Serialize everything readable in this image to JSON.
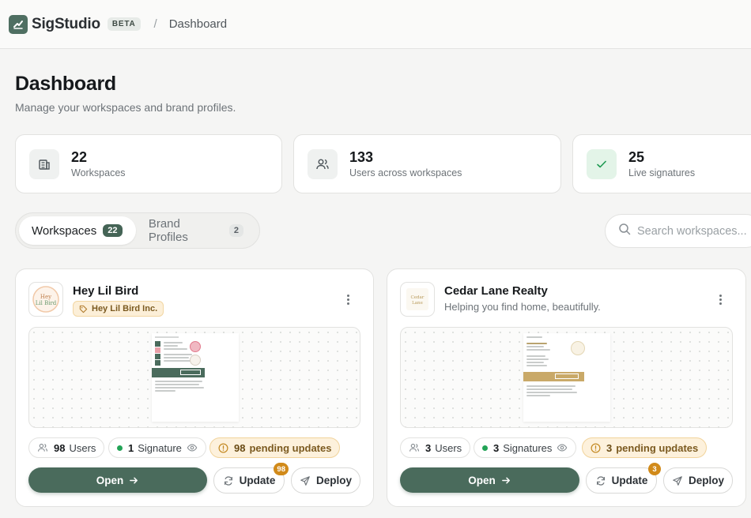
{
  "header": {
    "brand": "SigStudio",
    "beta": "BETA",
    "separator": "/",
    "breadcrumb": "Dashboard"
  },
  "page": {
    "title": "Dashboard",
    "subtitle": "Manage your workspaces and brand profiles."
  },
  "stats": [
    {
      "value": "22",
      "label": "Workspaces",
      "icon": "building-icon"
    },
    {
      "value": "133",
      "label": "Users across workspaces",
      "icon": "users-icon"
    },
    {
      "value": "25",
      "label": "Live signatures",
      "icon": "check-icon"
    }
  ],
  "tabs": [
    {
      "label": "Workspaces",
      "count": "22",
      "active": true
    },
    {
      "label": "Brand Profiles",
      "count": "2",
      "active": false
    }
  ],
  "search": {
    "placeholder": "Search workspaces..."
  },
  "workspaces": [
    {
      "name": "Hey Lil Bird",
      "logo_text": "Hey Lil Bird",
      "brand_profile": "Hey Lil Bird Inc.",
      "users_count": "98",
      "users_label": "Users",
      "signatures_count": "1",
      "signatures_label": "Signature",
      "pending_count": "98",
      "pending_label": "pending updates",
      "open_label": "Open",
      "update_label": "Update",
      "update_badge": "98",
      "deploy_label": "Deploy"
    },
    {
      "name": "Cedar Lane Realty",
      "logo_text": "Cedar Lane",
      "tagline": "Helping you find home, beautifully.",
      "users_count": "3",
      "users_label": "Users",
      "signatures_count": "3",
      "signatures_label": "Signatures",
      "pending_count": "3",
      "pending_label": "pending updates",
      "open_label": "Open",
      "update_label": "Update",
      "update_badge": "3",
      "deploy_label": "Deploy"
    }
  ],
  "colors": {
    "primary": "#4a6b5c",
    "warning_bg": "#fdf1dc",
    "warning_text": "#7b5a20",
    "success": "#22a356",
    "badge": "#d18a1a"
  }
}
